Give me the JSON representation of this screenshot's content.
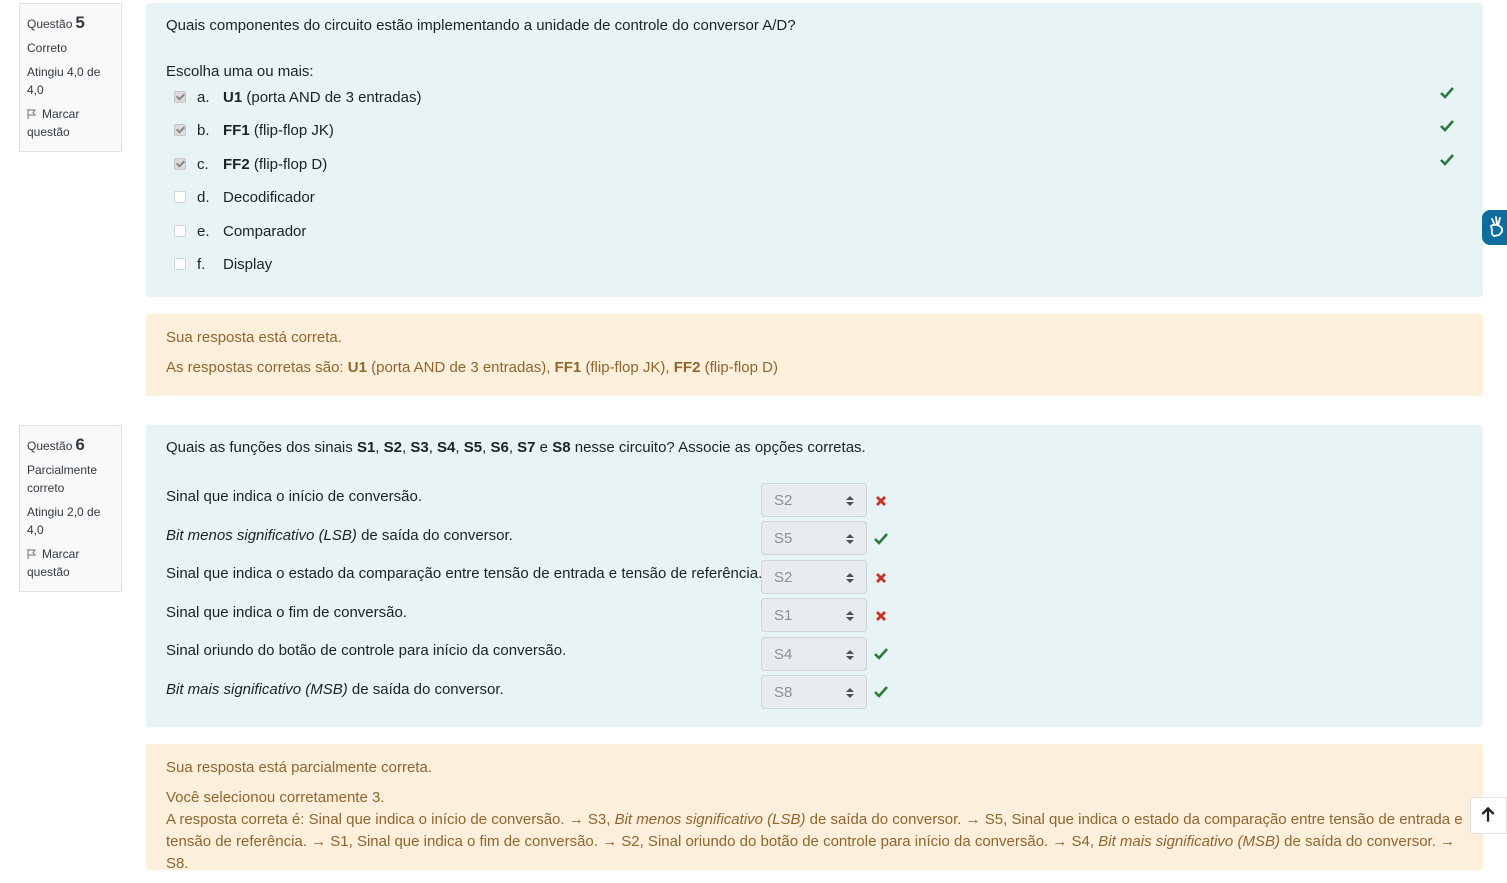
{
  "q5": {
    "info": {
      "label": "Questão",
      "number": "5",
      "state": "Correto",
      "grade": "Atingiu 4,0 de 4,0",
      "flag": "Marcar questão"
    },
    "question": "Quais componentes do circuito estão implementando a unidade de controle do conversor A/D?",
    "prompt": "Escolha uma ou mais:",
    "choices": [
      {
        "letter": "a.",
        "bold": "U1",
        "text": " (porta AND de 3 entradas)",
        "checked": true,
        "correct": true
      },
      {
        "letter": "b.",
        "bold": "FF1",
        "text": " (flip-flop JK)",
        "checked": true,
        "correct": true
      },
      {
        "letter": "c.",
        "bold": "FF2",
        "text": " (flip-flop D)",
        "checked": true,
        "correct": true
      },
      {
        "letter": "d.",
        "bold": "",
        "text": "Decodificador",
        "checked": false
      },
      {
        "letter": "e.",
        "bold": "",
        "text": "Comparador",
        "checked": false
      },
      {
        "letter": "f.",
        "bold": "",
        "text": "Display",
        "checked": false
      }
    ],
    "feedback": {
      "status": "Sua resposta está correta.",
      "prefix": "As respostas corretas são: ",
      "a1_bold": "U1",
      "a1": " (porta AND de 3 entradas), ",
      "a2_bold": "FF1",
      "a2": " (flip-flop JK), ",
      "a3_bold": "FF2",
      "a3": " (flip-flop D)"
    }
  },
  "q6": {
    "info": {
      "label": "Questão",
      "number": "6",
      "state": "Parcialmente correto",
      "grade": "Atingiu 2,0 de 4,0",
      "flag": "Marcar questão"
    },
    "question": {
      "p1": "Quais as funções dos sinais ",
      "s1": "S1",
      "c1": ", ",
      "s2": "S2",
      "c2": ", ",
      "s3": "S3",
      "c3": ", ",
      "s4": "S4",
      "c4": ", ",
      "s5": "S5",
      "c5": ", ",
      "s6": "S6",
      "c6": ", ",
      "s7": "S7",
      "and": " e ",
      "s8": "S8",
      "p2": " nesse circuito? Associe as opções corretas."
    },
    "rows": [
      {
        "italic": "",
        "label": "Sinal que indica o início de conversão.",
        "selected": "S2",
        "correct": false
      },
      {
        "italic": "Bit menos significativo (LSB)",
        "label": " de saída do conversor.",
        "selected": "S5",
        "correct": true
      },
      {
        "italic": "",
        "label": "Sinal que indica o estado da comparação entre tensão de entrada e tensão de referência.",
        "selected": "S2",
        "correct": false
      },
      {
        "italic": "",
        "label": "Sinal que indica o fim de conversão.",
        "selected": "S1",
        "correct": false
      },
      {
        "italic": "",
        "label": "Sinal oriundo do botão de controle para início da conversão.",
        "selected": "S4",
        "correct": true
      },
      {
        "italic": "Bit mais significativo (MSB)",
        "label": " de saída do conversor.",
        "selected": "S8",
        "correct": true
      }
    ],
    "feedback": {
      "status": "Sua resposta está parcialmente correta.",
      "count": "Você selecionou corretamente 3.",
      "t1": "A resposta correta é: Sinal que indica o início de conversão. → S3, ",
      "i1": "Bit menos significativo (LSB)",
      "t2": " de saída do conversor. → S5, Sinal que indica o estado da comparação entre tensão de entrada e",
      "t3": "tensão de referência. → S1, Sinal que indica o fim de conversão. → S2, Sinal oriundo do botão de controle para início da conversão. → S4, ",
      "i2": "Bit mais significativo (MSB)",
      "t4": " de saída do conversor. → S8."
    }
  },
  "colors": {
    "correct": "#2b7a3b",
    "incorrect": "#ca3120",
    "question_bg": "#e7f3f5",
    "feedback_bg": "#fcefdc",
    "feedback_text": "#8e662e"
  },
  "icons": {
    "flag": "flag-icon",
    "correct": "check-icon",
    "incorrect": "x-icon",
    "accessibility": "sign-language-icon",
    "top": "arrow-up-icon"
  }
}
